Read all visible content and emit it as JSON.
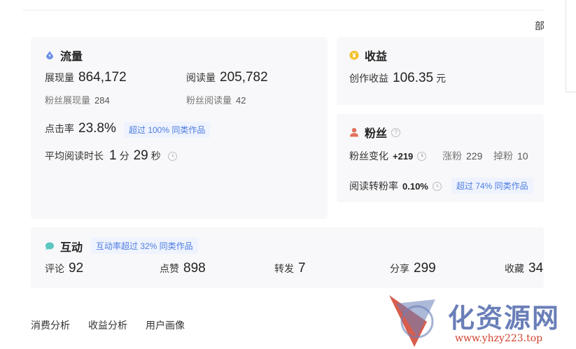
{
  "corner_text": "部",
  "traffic": {
    "title": "流量",
    "impressions_label": "展现量",
    "impressions_value": "864,172",
    "reads_label": "阅读量",
    "reads_value": "205,782",
    "fan_impressions_label": "粉丝展现量",
    "fan_impressions_value": "284",
    "fan_reads_label": "粉丝阅读量",
    "fan_reads_value": "42",
    "ctr_label": "点击率",
    "ctr_value": "23.8%",
    "ctr_badge": "超过 100% 同类作品",
    "avg_read_label": "平均阅读时长",
    "avg_read_min": "1",
    "avg_read_min_unit": "分",
    "avg_read_sec": "29",
    "avg_read_sec_unit": "秒"
  },
  "income": {
    "title": "收益",
    "label": "创作收益",
    "value": "106.35",
    "unit": "元"
  },
  "fans": {
    "title": "粉丝",
    "change_label": "粉丝变化",
    "change_value": "+219",
    "gain_label": "涨粉",
    "gain_value": "229",
    "loss_label": "掉粉",
    "loss_value": "10",
    "conv_label": "阅读转粉率",
    "conv_value": "0.10%",
    "conv_badge": "超过 74% 同类作品"
  },
  "interaction": {
    "title": "互动",
    "badge": "互动率超过 32% 同类作品",
    "comments_label": "评论",
    "comments_value": "92",
    "likes_label": "点赞",
    "likes_value": "898",
    "reposts_label": "转发",
    "reposts_value": "7",
    "shares_label": "分享",
    "shares_value": "299",
    "favorites_label": "收藏",
    "favorites_value": "34"
  },
  "tabs": [
    "消费分析",
    "收益分析",
    "用户画像"
  ],
  "watermark": {
    "text": "化资源网",
    "url": "www.yhzy223.top"
  },
  "colors": {
    "card_bg": "#f8f8fa",
    "badge_bg": "#eef3fd",
    "badge_text": "#4e7ce2",
    "traffic_icon": "#6b8ee8",
    "income_icon": "#f2c12e",
    "fans_icon": "#e2705c",
    "interaction_icon": "#5cc6c0"
  }
}
